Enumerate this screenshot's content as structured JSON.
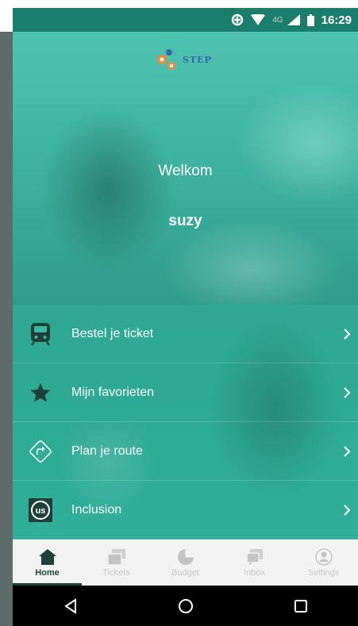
{
  "status_bar": {
    "network": "4G",
    "time": "16:29"
  },
  "hero": {
    "logo_text": "STEP",
    "welcome": "Welkom",
    "username": "suzy"
  },
  "menu": {
    "items": [
      {
        "label": "Bestel je ticket",
        "icon": "train-icon"
      },
      {
        "label": "Mijn favorieten",
        "icon": "star-icon"
      },
      {
        "label": "Plan je route",
        "icon": "route-icon"
      },
      {
        "label": "Inclusion",
        "icon": "inclusion-us-icon",
        "badge": "us"
      }
    ]
  },
  "tabs": [
    {
      "label": "Home",
      "icon": "home-icon",
      "active": true
    },
    {
      "label": "Tickets",
      "icon": "tickets-icon",
      "active": false
    },
    {
      "label": "Budget",
      "icon": "budget-pie-icon",
      "active": false
    },
    {
      "label": "Inbox",
      "icon": "inbox-icon",
      "active": false
    },
    {
      "label": "Settings",
      "icon": "settings-user-icon",
      "active": false
    }
  ],
  "colors": {
    "status_bar": "#1b7d6c",
    "hero": "#3bb8a4",
    "menu": "#2ea892",
    "tab_active": "#1f3f3b",
    "tab_inactive": "#c9c9c9",
    "icon_dark": "#1f3f3b"
  }
}
